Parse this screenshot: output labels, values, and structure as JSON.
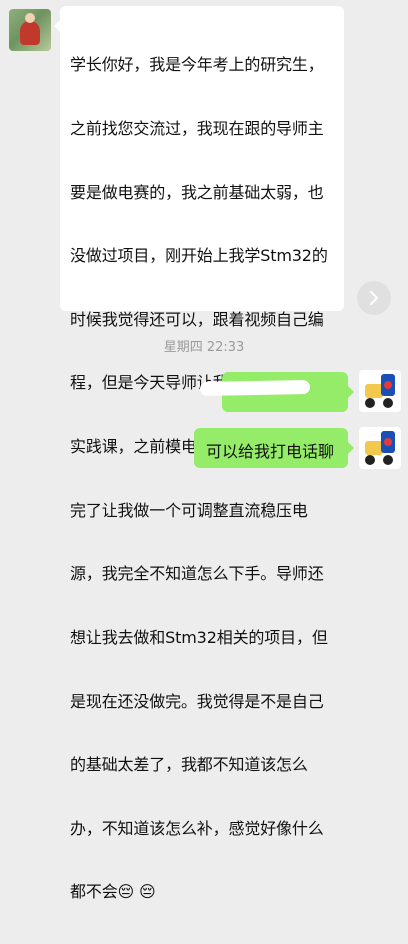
{
  "incoming": {
    "lines": [
      "学长你好，我是今年考上的研究生，",
      "之前找您交流过，我现在跟的导师主",
      "要是做电赛的，我之前基础太弱，也",
      "没做过项目，刚开始上我学Stm32的",
      "时候我觉得还可以，跟着视频自己编",
      "程，但是今天导师让我去听本科生的",
      "实践课，之前模电什么的都没学好，",
      "完了让我做一个可调整直流稳压电",
      "源，我完全不知道怎么下手。导师还",
      "想让我去做和Stm32相关的项目，但",
      "是现在还没做完。我觉得是不是自己",
      "的基础太差了，我都不知道该怎么",
      "办，不知道该怎么补，感觉好像什么",
      "都不会😔 😔"
    ]
  },
  "timestamp": "星期四 22:33",
  "outgoing": [
    {
      "text": ""
    },
    {
      "text": "可以给我打电话聊"
    }
  ],
  "icons": {
    "forward": "chevron-right-icon",
    "left_avatar": "avatar",
    "right_avatar": "avatar"
  },
  "colors": {
    "background": "#ededed",
    "incoming_bubble": "#ffffff",
    "outgoing_bubble": "#95ec69",
    "timestamp": "#9a9a9a"
  }
}
